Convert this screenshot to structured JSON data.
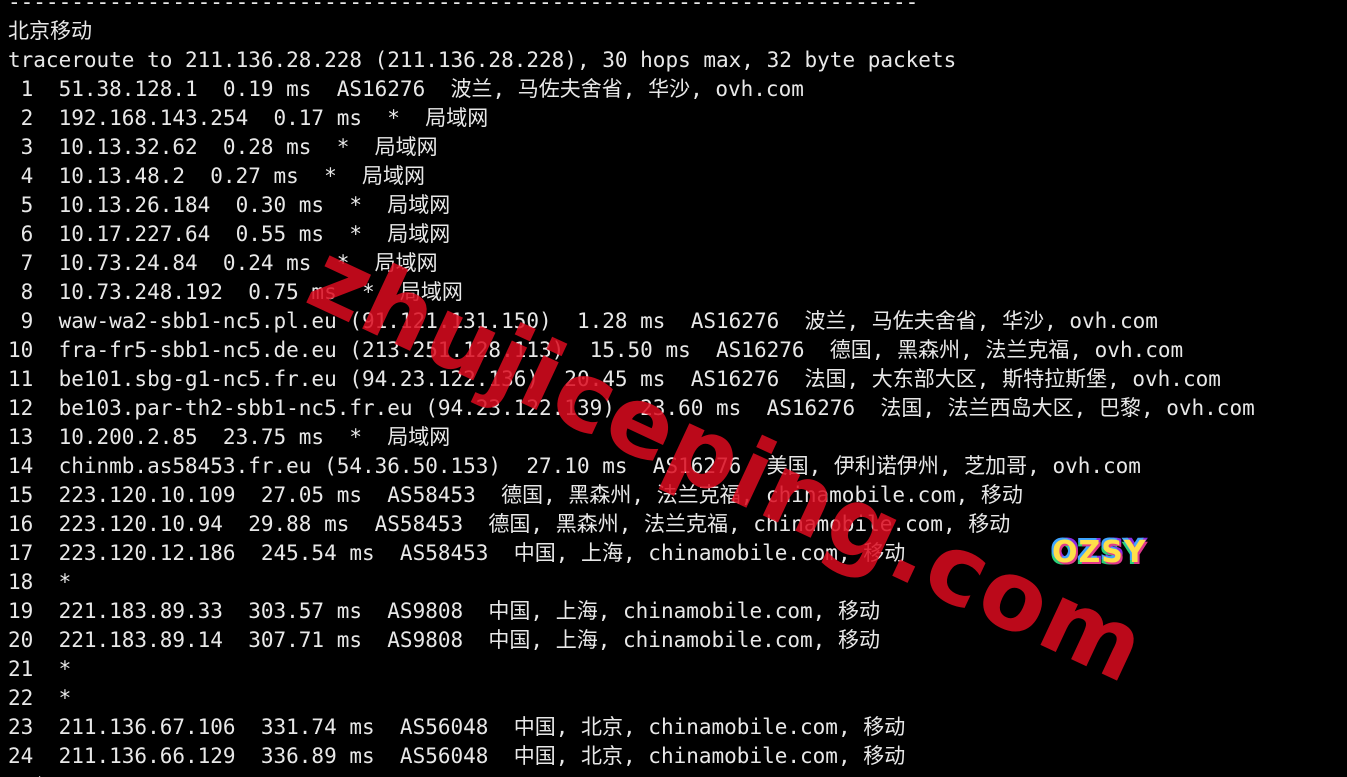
{
  "terminal": {
    "lines": [
      "------------------------------------------------------------------------",
      "北京移动",
      "traceroute to 211.136.28.228 (211.136.28.228), 30 hops max, 32 byte packets",
      " 1  51.38.128.1  0.19 ms  AS16276  波兰, 马佐夫舍省, 华沙, ovh.com",
      " 2  192.168.143.254  0.17 ms  *  局域网",
      " 3  10.13.32.62  0.28 ms  *  局域网",
      " 4  10.13.48.2  0.27 ms  *  局域网",
      " 5  10.13.26.184  0.30 ms  *  局域网",
      " 6  10.17.227.64  0.55 ms  *  局域网",
      " 7  10.73.24.84  0.24 ms  *  局域网",
      " 8  10.73.248.192  0.75 ms  *  局域网",
      " 9  waw-wa2-sbb1-nc5.pl.eu (91.121.131.150)  1.28 ms  AS16276  波兰, 马佐夫舍省, 华沙, ovh.com",
      "10  fra-fr5-sbb1-nc5.de.eu (213.251.128.113)  15.50 ms  AS16276  德国, 黑森州, 法兰克福, ovh.com",
      "11  be101.sbg-g1-nc5.fr.eu (94.23.122.136)  20.45 ms  AS16276  法国, 大东部大区, 斯特拉斯堡, ovh.com",
      "12  be103.par-th2-sbb1-nc5.fr.eu (94.23.122.139)  23.60 ms  AS16276  法国, 法兰西岛大区, 巴黎, ovh.com",
      "13  10.200.2.85  23.75 ms  *  局域网",
      "14  chinmb.as58453.fr.eu (54.36.50.153)  27.10 ms  AS16276  美国, 伊利诺伊州, 芝加哥, ovh.com",
      "15  223.120.10.109  27.05 ms  AS58453  德国, 黑森州, 法兰克福, chinamobile.com, 移动",
      "16  223.120.10.94  29.88 ms  AS58453  德国, 黑森州, 法兰克福, chinamobile.com, 移动",
      "17  223.120.12.186  245.54 ms  AS58453  中国, 上海, chinamobile.com, 移动",
      "18  *",
      "19  221.183.89.33  303.57 ms  AS9808  中国, 上海, chinamobile.com, 移动",
      "20  221.183.89.14  307.71 ms  AS9808  中国, 上海, chinamobile.com, 移动",
      "21  *",
      "22  *",
      "23  211.136.67.106  331.74 ms  AS56048  中国, 北京, chinamobile.com, 移动",
      "24  211.136.66.129  336.89 ms  AS56048  中国, 北京, chinamobile.com, 移动",
      "  *"
    ]
  },
  "watermark": {
    "text": "zhujiceping.com",
    "color": "#dc0a1e"
  },
  "logo": {
    "text": "OZSY"
  },
  "colors": {
    "background": "#000000",
    "foreground": "#e8e8e8"
  }
}
